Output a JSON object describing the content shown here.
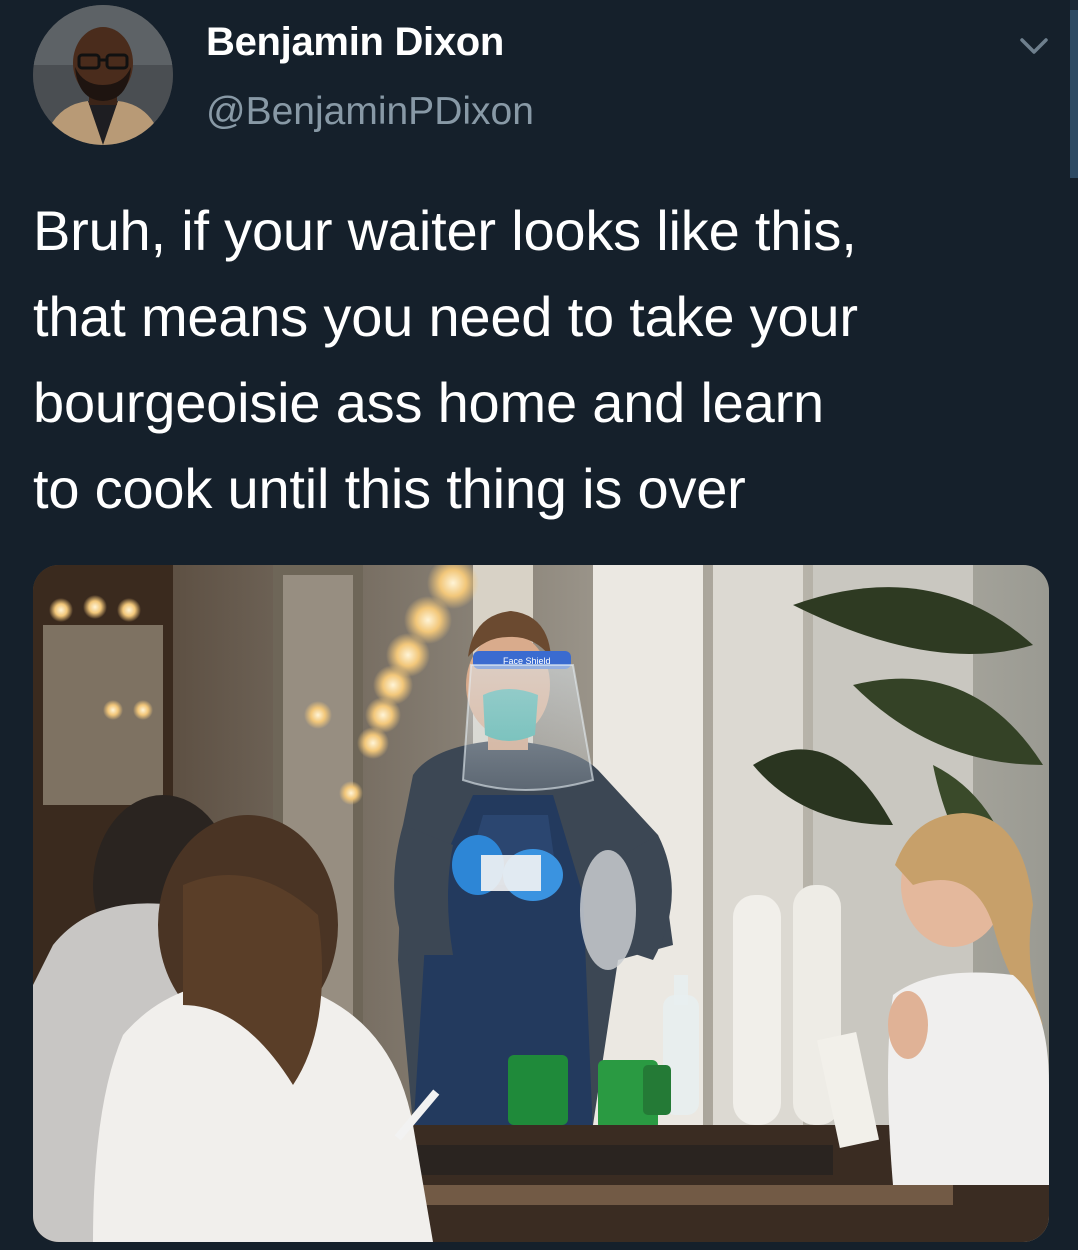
{
  "author": {
    "display_name": "Benjamin Dixon",
    "handle": "@BenjaminPDixon",
    "avatar_icon": "profile-photo"
  },
  "tweet": {
    "text_lines": [
      "Bruh, if your waiter looks like this,",
      "that means you need to take your",
      "bourgeoisie ass home and learn",
      "to cook until this thing is over"
    ]
  },
  "media": {
    "face_shield_label": "Face Shield"
  },
  "menu": {
    "icon": "chevron-down-icon"
  },
  "colors": {
    "background": "#15202b",
    "name": "#ffffff",
    "handle": "#8899a6",
    "text": "#ffffff"
  }
}
